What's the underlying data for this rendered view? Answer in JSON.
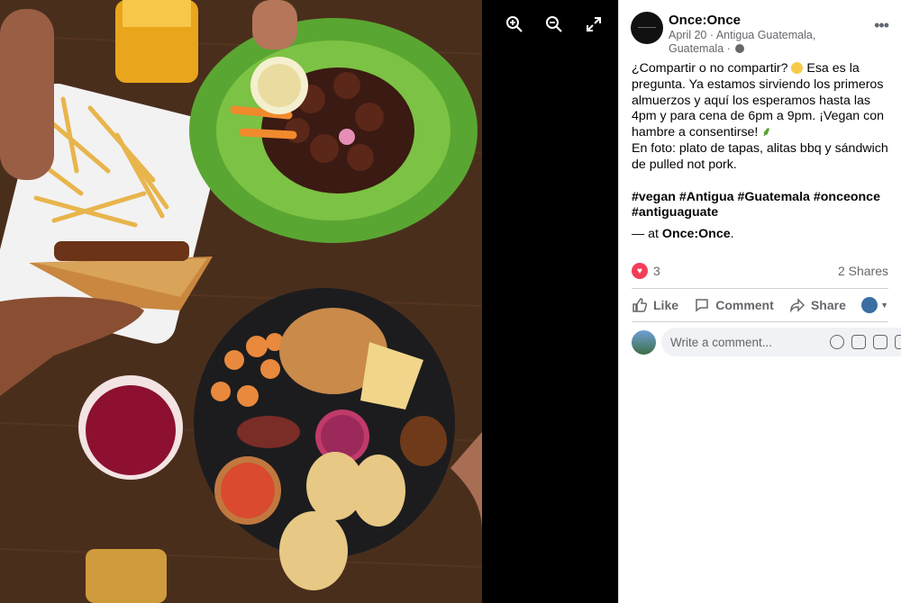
{
  "post": {
    "page_name": "Once:Once",
    "date": "April 20",
    "location": "Antigua Guatemala, Guatemala",
    "separator": "·",
    "text_line1": "¿Compartir o no compartir?",
    "text_line1b": "Esa es la pregunta. Ya estamos sirviendo los primeros almuerzos y aquí los esperamos hasta las 4pm y para cena de 6pm a 9pm. ¡Vegan con hambre a consentirse!",
    "text_line2": "En foto: plato de tapas, alitas bbq y sándwich de pulled not pork.",
    "hashtags": "#vegan #Antigua #Guatemala #onceonce #antiguaguate",
    "at_prefix": "— at",
    "at_place": "Once:Once",
    "at_suffix": "."
  },
  "reactions": {
    "count": "3",
    "shares": "2 Shares"
  },
  "actions": {
    "like": "Like",
    "comment": "Comment",
    "share": "Share"
  },
  "comment": {
    "placeholder": "Write a comment..."
  },
  "icons": {
    "zoom_in": "zoom-in-icon",
    "zoom_out": "zoom-out-icon",
    "fullscreen": "fullscreen-icon",
    "more": "more-options-icon",
    "globe": "globe-icon",
    "love": "love-reaction-icon"
  },
  "colors": {
    "love": "#f33e58",
    "text": "#050505",
    "meta": "#65676b",
    "viewer_bg": "#000000"
  }
}
